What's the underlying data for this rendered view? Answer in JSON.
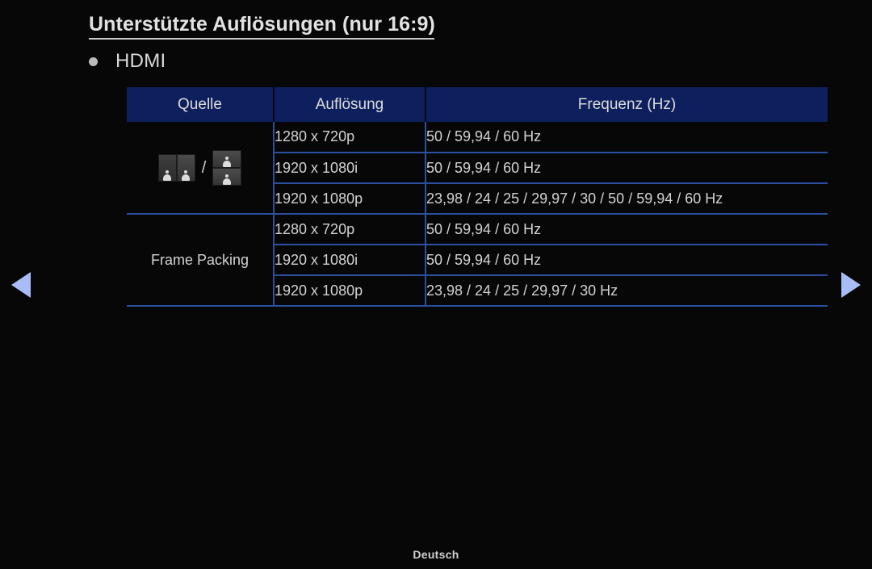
{
  "page": {
    "title": "Unterstützte Auflösungen (nur 16:9)",
    "bullet_label": "HDMI",
    "bullet_icon": "bullet-dot-icon",
    "footer_language": "Deutsch",
    "background_color": "#070707",
    "accent_header_color": "#0d1f5c",
    "grid_line_color": "#2c4f9e",
    "arrow_color": "#a8bdf5",
    "text_color": "#d2d2d2"
  },
  "nav": {
    "prev_label": "◀",
    "prev_icon": "triangle-left-icon",
    "next_label": "▶",
    "next_icon": "triangle-right-icon"
  },
  "table": {
    "headers": [
      "Quelle",
      "Auflösung",
      "Frequenz (Hz)"
    ],
    "groups": [
      {
        "source_label": "",
        "source_type": "icon",
        "source_icons": [
          "side-by-side-3d-icon",
          "top-bottom-3d-icon"
        ],
        "source_separator": "/",
        "rows": [
          {
            "resolution": "1280 x 720p",
            "frequency": "50 / 59,94 / 60 Hz"
          },
          {
            "resolution": "1920 x 1080i",
            "frequency": "50 / 59,94 / 60 Hz"
          },
          {
            "resolution": "1920 x 1080p",
            "frequency": "23,98 / 24 / 25 / 29,97 / 30 / 50 / 59,94 / 60 Hz"
          }
        ]
      },
      {
        "source_label": "Frame Packing",
        "source_type": "text",
        "source_icons": [],
        "source_separator": "",
        "rows": [
          {
            "resolution": "1280 x 720p",
            "frequency": "50 / 59,94 / 60 Hz"
          },
          {
            "resolution": "1920 x 1080i",
            "frequency": "50 / 59,94 / 60 Hz"
          },
          {
            "resolution": "1920 x 1080p",
            "frequency": "23,98 / 24 / 25 / 29,97 / 30 Hz"
          }
        ]
      }
    ]
  }
}
